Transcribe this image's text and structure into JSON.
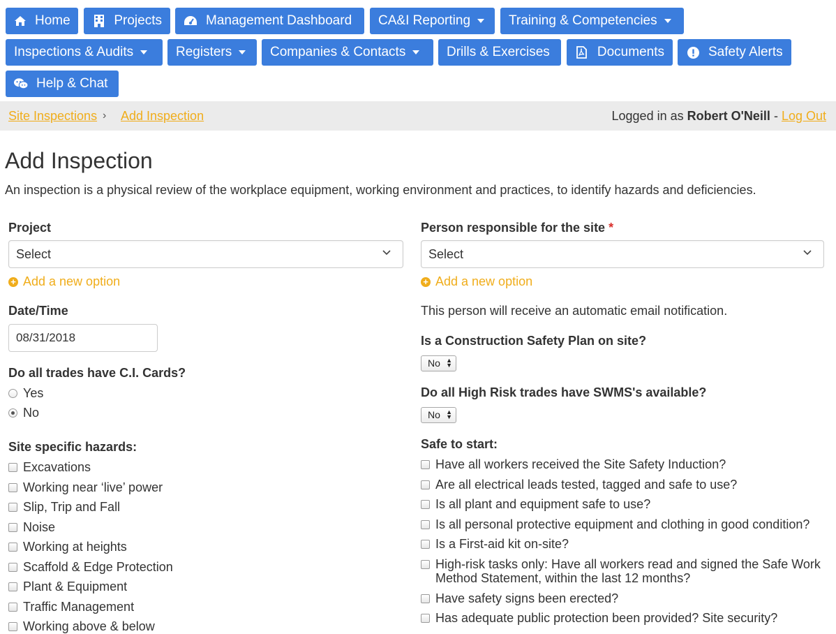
{
  "nav": {
    "home": "Home",
    "projects": "Projects",
    "management_dashboard": "Management Dashboard",
    "cai_reporting": "CA&I Reporting",
    "training": "Training & Competencies",
    "inspections": "Inspections & Audits",
    "registers": "Registers",
    "companies": "Companies & Contacts",
    "drills": "Drills & Exercises",
    "documents": "Documents",
    "safety_alerts": "Safety Alerts",
    "help_chat": "Help & Chat"
  },
  "breadcrumb": {
    "site_inspections": "Site Inspections",
    "separator": "›",
    "add_inspection": "Add Inspection"
  },
  "session": {
    "logged_in_as": "Logged in as",
    "user": "Robert O'Neill",
    "dash": "-",
    "logout": "Log Out"
  },
  "page": {
    "title": "Add Inspection",
    "intro": "An inspection is a physical review of the workplace equipment, working environment and practices, to identify hazards and deficiencies."
  },
  "form": {
    "project_label": "Project",
    "project_value": "Select",
    "add_new_option": "Add a new option",
    "person_label": "Person responsible for the site",
    "required_mark": "*",
    "person_value": "Select",
    "person_note": "This person will receive an automatic email notification.",
    "datetime_label": "Date/Time",
    "datetime_value": "08/31/2018",
    "ci_cards_label": "Do all trades have C.I. Cards?",
    "ci_yes": "Yes",
    "ci_no": "No",
    "ci_selected": "No",
    "csp_label": "Is a Construction Safety Plan on site?",
    "csp_value": "No",
    "swms_label": "Do all High Risk trades have SWMS's available?",
    "swms_value": "No",
    "hazards_label": "Site specific hazards:",
    "hazards": [
      "Excavations",
      "Working near ‘live’ power",
      "Slip, Trip and Fall",
      "Noise",
      "Working at heights",
      "Scaffold & Edge Protection",
      "Plant & Equipment",
      "Traffic Management",
      "Working above & below"
    ],
    "safe_label": "Safe to start:",
    "safe_items": [
      "Have all workers received the Site Safety Induction?",
      "Are all electrical leads tested, tagged and safe to use?",
      "Is all plant and equipment safe to use?",
      "Is all personal protective equipment and clothing in good condition?",
      "Is a First-aid kit on-site?",
      "High-risk tasks only: Have all workers read and signed the Safe Work Method Statement, within the last 12 months?",
      "Have safety signs been erected?",
      "Has adequate public protection been provided? Site security?"
    ]
  },
  "colors": {
    "nav_blue": "#3b7ddd",
    "link_orange": "#f0ad1b",
    "required_red": "#d9302c",
    "crumb_bg": "#ebebeb"
  },
  "icons": {
    "home": "home-icon",
    "projects": "building-icon",
    "dashboard": "dashboard-icon",
    "documents": "pdf-file-icon",
    "safety_alerts": "exclamation-circle-icon",
    "help_chat": "chat-icon"
  }
}
